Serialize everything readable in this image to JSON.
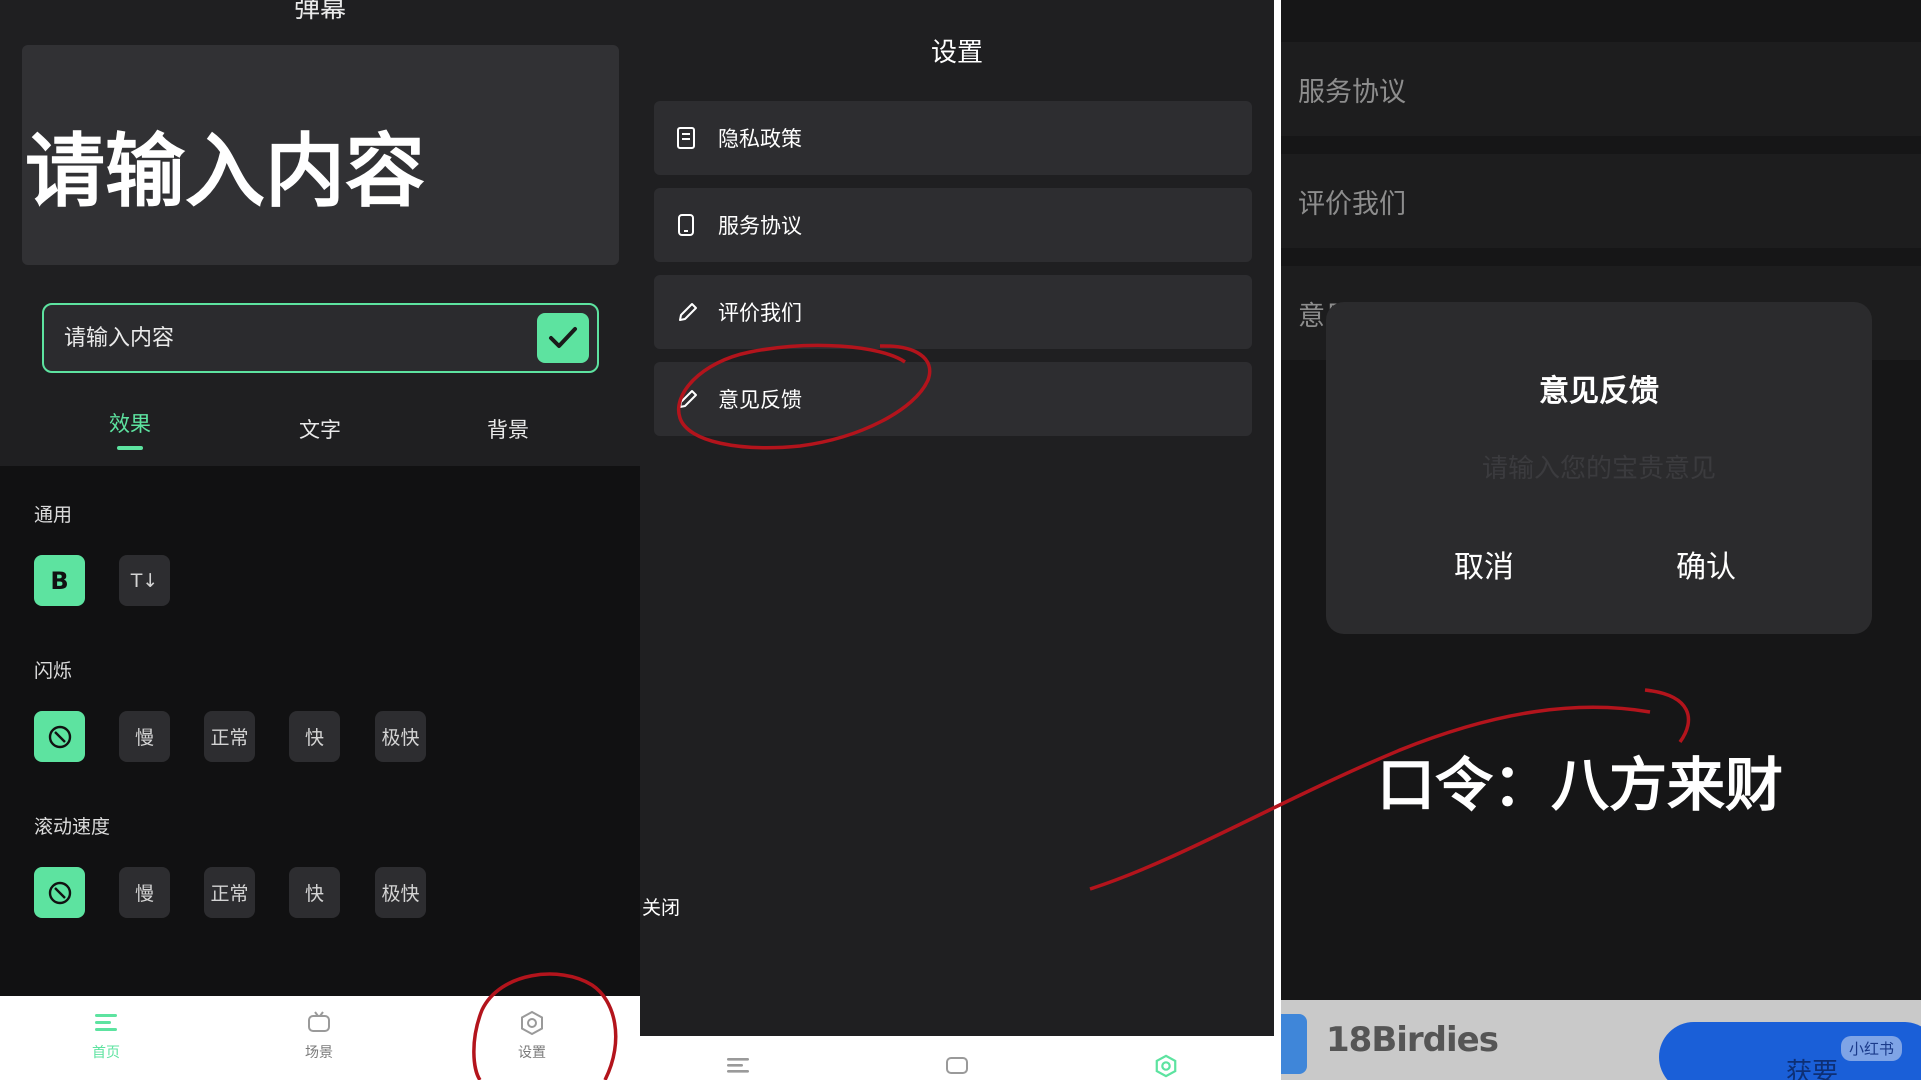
{
  "panel1": {
    "top_title": "弹幕",
    "preview_text": "请输入内容",
    "input_placeholder": "请输入内容",
    "tabs": [
      {
        "label": "效果",
        "active": true
      },
      {
        "label": "文字",
        "active": false
      },
      {
        "label": "背景",
        "active": false
      }
    ],
    "sections": {
      "general": {
        "label": "通用",
        "bold": "B",
        "text_size": "T↓"
      },
      "flash": {
        "label": "闪烁",
        "options": [
          "慢",
          "正常",
          "快",
          "极快"
        ]
      },
      "scroll": {
        "label": "滚动速度",
        "options": [
          "慢",
          "正常",
          "快",
          "极快"
        ]
      }
    },
    "nav": [
      {
        "label": "首页",
        "icon": "home-icon",
        "active": true
      },
      {
        "label": "场景",
        "icon": "scene-icon",
        "active": false
      },
      {
        "label": "设置",
        "icon": "settings-icon",
        "active": false
      }
    ]
  },
  "panel2": {
    "title": "设置",
    "items": [
      {
        "label": "隐私政策",
        "icon": "document-icon"
      },
      {
        "label": "服务协议",
        "icon": "phone-icon"
      },
      {
        "label": "评价我们",
        "icon": "pencil-icon"
      },
      {
        "label": "意见反馈",
        "icon": "pencil-icon"
      }
    ],
    "close_label": "关闭"
  },
  "panel3": {
    "items": [
      "服务协议",
      "评价我们",
      "意见"
    ],
    "dialog": {
      "title": "意见反馈",
      "placeholder": "请输入您的宝贵意见",
      "cancel": "取消",
      "confirm": "确认"
    },
    "overlay_text": "口令：八方来财",
    "ad": {
      "brand": "18Birdies",
      "button": "获要",
      "badge": "小红书"
    }
  },
  "colors": {
    "accent": "#5de3a0",
    "annotation": "#b3141c",
    "ad_blue": "#1a5fd8"
  }
}
